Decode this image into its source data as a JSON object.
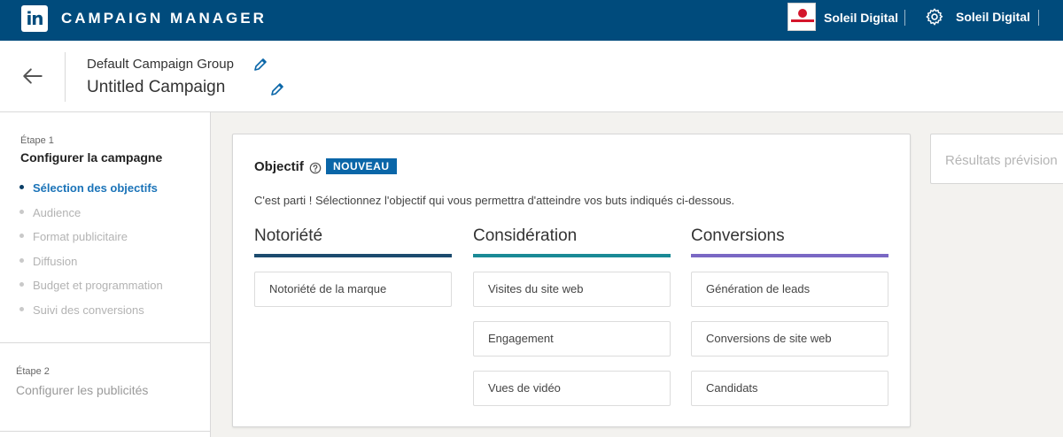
{
  "topbar": {
    "logo_text": "in",
    "app_title": "CAMPAIGN MANAGER",
    "account_name": "Soleil Digital",
    "settings_account_name": "Soleil Digital",
    "bg_color": "#004b7c"
  },
  "header": {
    "group_name": "Default Campaign Group",
    "campaign_name": "Untitled Campaign"
  },
  "sidebar": {
    "step1_label": "Étape 1",
    "step1_title": "Configurer la campagne",
    "items": [
      {
        "label": "Sélection des objectifs",
        "active": true
      },
      {
        "label": "Audience",
        "active": false
      },
      {
        "label": "Format publicitaire",
        "active": false
      },
      {
        "label": "Diffusion",
        "active": false
      },
      {
        "label": "Budget et programmation",
        "active": false
      },
      {
        "label": "Suivi des conversions",
        "active": false
      }
    ],
    "step2_label": "Étape 2",
    "step2_title": "Configurer les publicités"
  },
  "objective": {
    "title": "Objectif",
    "badge": "NOUVEAU",
    "intro": "C'est parti ! Sélectionnez l'objectif qui vous permettra d'atteindre vos buts indiqués ci-dessous.",
    "columns": [
      {
        "heading": "Notoriété",
        "color": "#1c4b6e",
        "options": [
          "Notoriété de la marque"
        ]
      },
      {
        "heading": "Considération",
        "color": "#1a8a96",
        "options": [
          "Visites du site web",
          "Engagement",
          "Vues de vidéo"
        ]
      },
      {
        "heading": "Conversions",
        "color": "#7a68c4",
        "options": [
          "Génération de leads",
          "Conversions de site web",
          "Candidats"
        ]
      }
    ]
  },
  "preview": {
    "title": "Résultats prévision"
  },
  "icons": {
    "back": "arrow-left-icon",
    "edit": "pencil-icon",
    "help": "question-circle-icon",
    "settings": "gear-icon"
  }
}
